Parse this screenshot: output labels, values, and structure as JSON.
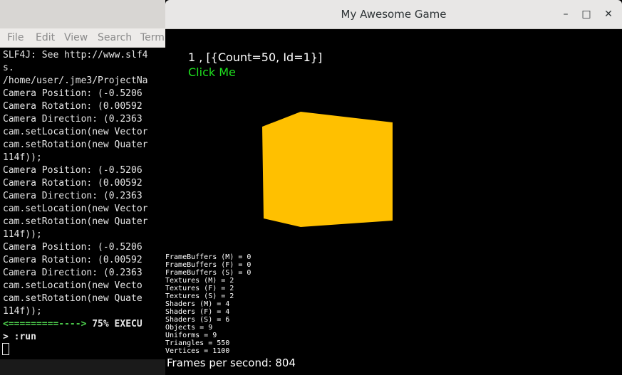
{
  "terminal": {
    "menu": [
      "File",
      "Edit",
      "View",
      "Search",
      "Termi"
    ],
    "lines": [
      "SLF4J: See http://www.slf4",
      "s.",
      "/home/user/.jme3/ProjectNa",
      "Camera Position: (-0.5206",
      "Camera Rotation: (0.00592",
      "Camera Direction: (0.2363",
      "cam.setLocation(new Vector",
      "cam.setRotation(new Quater",
      "114f));",
      "Camera Position: (-0.5206",
      "Camera Rotation: (0.00592",
      "Camera Direction: (0.2363",
      "cam.setLocation(new Vector",
      "cam.setRotation(new Quater",
      "114f));",
      "Camera Position: (-0.5206",
      "Camera Rotation: (0.00592",
      "Camera Direction: (0.2363",
      "cam.setLocation(new Vecto",
      "cam.setRotation(new Quate",
      "114f));"
    ],
    "progress_bar": "<=========---->",
    "progress_text": " 75% EXECU",
    "prompt": "> :run"
  },
  "game": {
    "title": "My Awesome Game",
    "minimize_label": "–",
    "maximize_label": "□",
    "close_label": "✕",
    "hud_text": "1 , [{Count=50, Id=1}]",
    "button_label": "Click Me",
    "cube_color": "#ffc000",
    "stats": [
      "FrameBuffers (M) = 0",
      "FrameBuffers (F) = 0",
      "FrameBuffers (S) = 0",
      "Textures (M) = 2",
      "Textures (F) = 2",
      "Textures (S) = 2",
      "Shaders (M) = 4",
      "Shaders (F) = 4",
      "Shaders (S) = 6",
      "Objects = 9",
      "Uniforms = 9",
      "Triangles = 550",
      "Vertices = 1100"
    ],
    "fps": "Frames per second: 804"
  }
}
